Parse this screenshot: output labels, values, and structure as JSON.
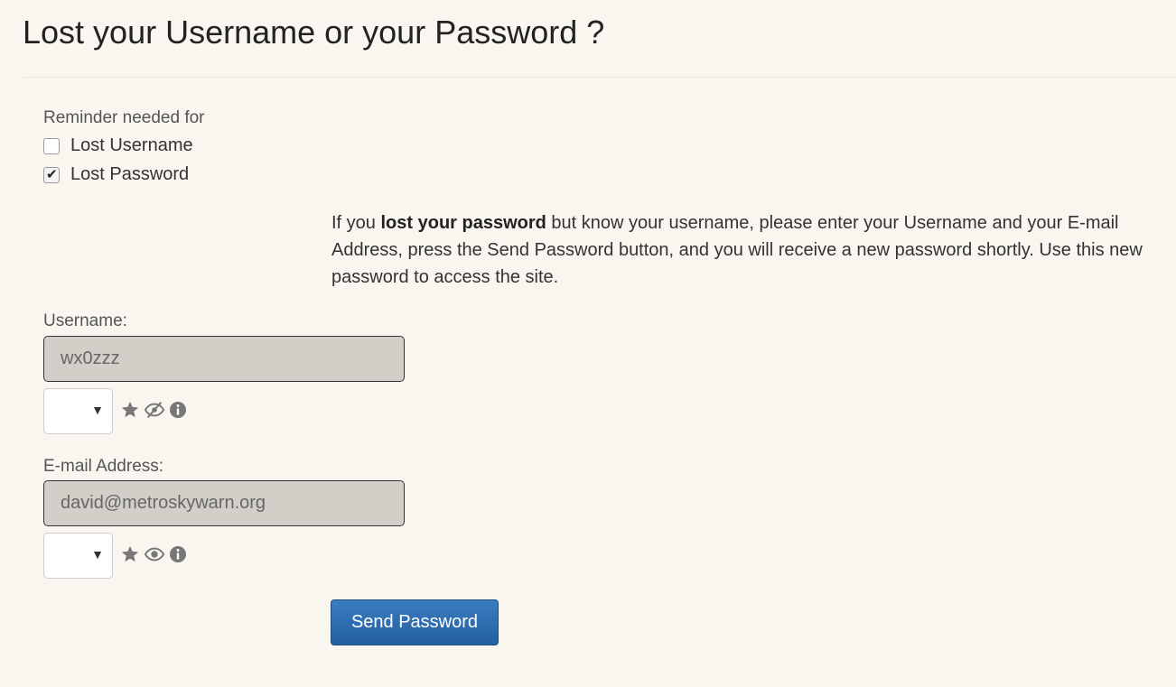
{
  "page": {
    "title": "Lost your Username or your Password ?"
  },
  "reminder": {
    "label": "Reminder needed for",
    "options": [
      {
        "label": "Lost Username",
        "checked": false
      },
      {
        "label": "Lost Password",
        "checked": true
      }
    ]
  },
  "info": {
    "prefix": "If you ",
    "bold": "lost your password",
    "suffix": " but know your username, please enter your Username and your E-mail Address, press the Send Password button, and you will receive a new password shortly. Use this new password to access the site."
  },
  "form": {
    "username": {
      "label": "Username:",
      "value": "wx0zzz",
      "icons": [
        "star-icon",
        "eye-slash-icon",
        "info-icon"
      ]
    },
    "email": {
      "label": "E-mail Address:",
      "value": "david@metroskywarn.org",
      "icons": [
        "star-icon",
        "eye-icon",
        "info-icon"
      ]
    },
    "submit_label": "Send Password"
  },
  "colors": {
    "background": "#f9f5ef",
    "input_background": "#d2cec8",
    "button": "#2a69ac",
    "icon": "#777777"
  }
}
